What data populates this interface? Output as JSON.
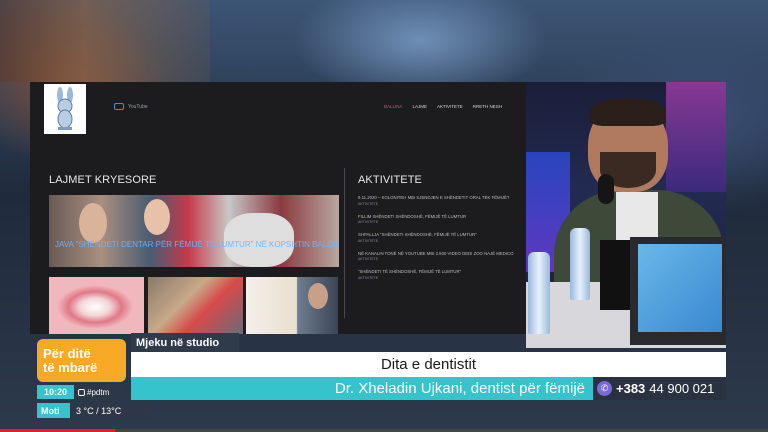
{
  "website": {
    "youtube_label": "YouTube",
    "nav": [
      "BALLINA",
      "LAJME",
      "AKTIVITETE",
      "RRETH NESH"
    ],
    "main_title": "LAJMET KRYESORE",
    "hero_caption": "JAVA \"SHËNDETI DENTAR PËR FËMIJË TË LUMTUR\" NË KOPSHTIN BALONAT",
    "side_title": "AKTIVITETE",
    "news": [
      {
        "text": "9.11.2020 – KOLONITEH MBI SJENDJEN E SHËNDETIT ORAL TEK FËMIJËT",
        "tag": "AKTIVITETE"
      },
      {
        "text": "FILLIM SHËNDETI SHËNDOSHË, FËMIJË TË LUMTUR",
        "tag": "AKTIVITETE"
      },
      {
        "text": "SHPALLJA \"SHËNDETI SHËNDOSHË, FËMIJË TË LUMTUR\"",
        "tag": "AKTIVITETE"
      },
      {
        "text": "NË KANALIN TONË NË YOUTUBE MBI 2.500 VIDEO DEDI ZOO NAJË MEDICO",
        "tag": "AKTIVITETE"
      },
      {
        "text": "\"SHËNDETI TË SHËNDOSHË, FËMIJË TË LUMTUR\"",
        "tag": "AKTIVITETE"
      }
    ]
  },
  "lower_third": {
    "brand_line1": "Për ditë",
    "brand_line2": "të mbarë",
    "category": "Mjeku në studio",
    "headline": "Dita e dentistit",
    "guest": "Dr. Xheladin Ujkani, dentist për fëmijë",
    "phone_prefix": "+383",
    "phone_number": "44 900 021",
    "time": "10:20",
    "hashtag": "#pdtm",
    "weather_label": "Moti",
    "weather_temp": "3 °C / 13°C"
  },
  "icons": {
    "whatsapp": "whatsapp-icon",
    "instagram": "instagram-icon"
  },
  "colors": {
    "brand_orange": "#f7a824",
    "accent_teal": "#35c4cc",
    "dark_panel": "#2d3748",
    "progress_red": "#e02020"
  },
  "playback": {
    "progress_fraction": 0.15
  }
}
